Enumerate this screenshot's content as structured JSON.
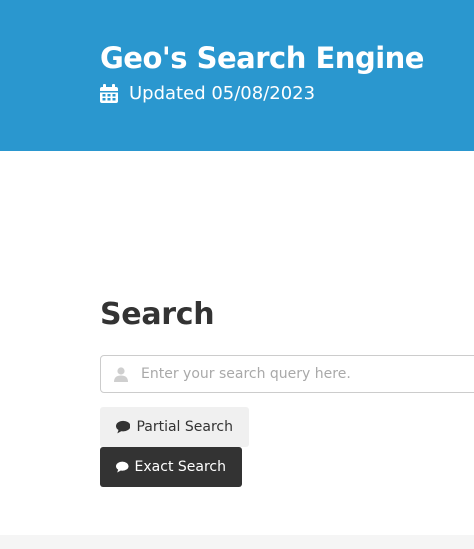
{
  "header": {
    "title": "Geo's Search Engine",
    "updated_icon": "calendar-icon",
    "updated_text": "Updated 05/08/2023"
  },
  "search": {
    "heading": "Search",
    "input_icon": "user-icon",
    "placeholder": "Enter your search query here.",
    "value": ""
  },
  "buttons": {
    "partial_label": "Partial Search",
    "exact_label": "Exact Search",
    "icon": "comment-icon"
  },
  "colors": {
    "header_bg": "#2a97cf",
    "text": "#333333",
    "partial_bg": "#f0f0f0",
    "exact_bg": "#333333"
  }
}
